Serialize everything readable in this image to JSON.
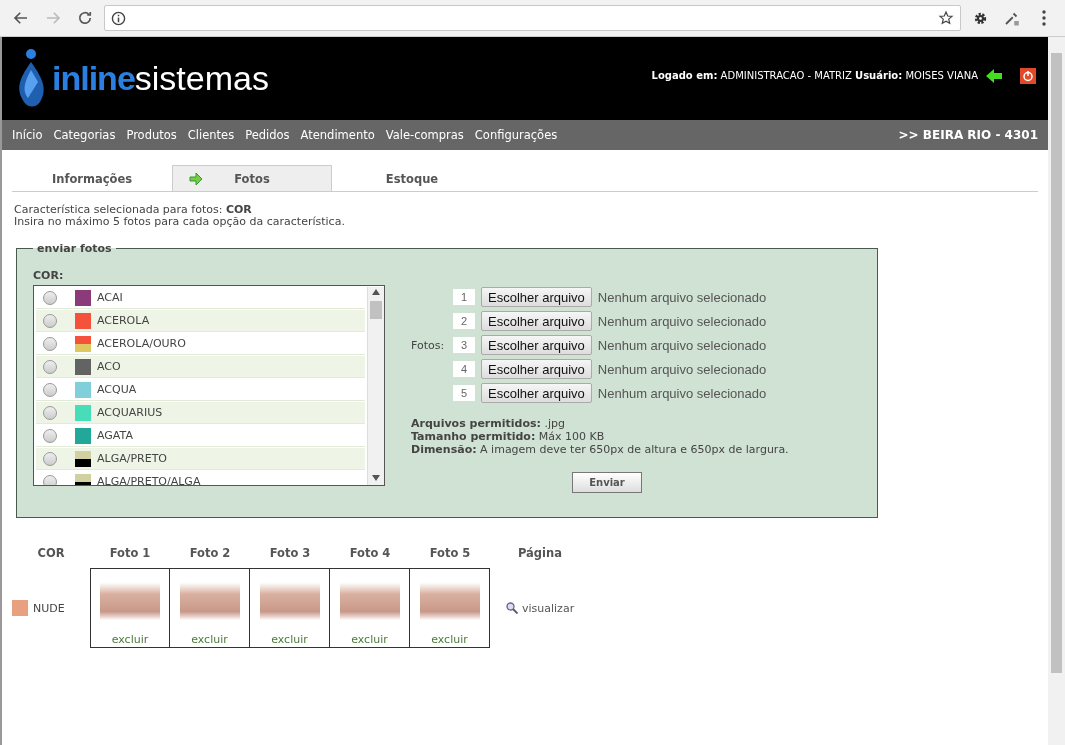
{
  "browser": {
    "nav_buttons": [
      {
        "kind": "back",
        "disabled": false
      },
      {
        "kind": "forward",
        "disabled": true
      },
      {
        "kind": "reload",
        "disabled": false
      }
    ]
  },
  "header": {
    "logo": {
      "part_1": "inline",
      "part_2": "sistemas"
    },
    "session": {
      "logged_label": "Logado em:",
      "location": "ADMINISTRACAO - MATRIZ",
      "user_label": "Usuário:",
      "user": "MOISES VIANA"
    }
  },
  "nav": {
    "items": [
      "Início",
      "Categorias",
      "Produtos",
      "Clientes",
      "Pedidos",
      "Atendimento",
      "Vale-compras",
      "Configurações"
    ],
    "store": ">> BEIRA RIO - 4301"
  },
  "tabs": [
    {
      "label": "Informações",
      "selected": false
    },
    {
      "label": "Fotos",
      "selected": true
    },
    {
      "label": "Estoque",
      "selected": false
    }
  ],
  "info": [
    "Característica selecionada para fotos: **COR**",
    "Insira no máximo 5 fotos para cada opção da característica."
  ],
  "upload": {
    "legend": "enviar fotos",
    "list_label": "COR:",
    "colors": [
      {
        "name": "ACAI",
        "stripes": [
          {
            "color": "#8b3a7a"
          }
        ],
        "selected": false
      },
      {
        "name": "ACEROLA",
        "stripes": [
          {
            "color": "#f4523a"
          }
        ],
        "selected": false
      },
      {
        "name": "ACEROLA/OURO",
        "stripes": [
          {
            "color": "#f4523a"
          },
          {
            "color": "#e0c860"
          }
        ],
        "selected": false
      },
      {
        "name": "ACO",
        "stripes": [
          {
            "color": "#636363"
          }
        ],
        "selected": false
      },
      {
        "name": "ACQUA",
        "stripes": [
          {
            "color": "#80d0dc"
          }
        ],
        "selected": false
      },
      {
        "name": "ACQUARIUS",
        "stripes": [
          {
            "color": "#48dcb8"
          }
        ],
        "selected": false
      },
      {
        "name": "AGATA",
        "stripes": [
          {
            "color": "#22a898"
          }
        ],
        "selected": false
      },
      {
        "name": "ALGA/PRETO",
        "stripes": [
          {
            "color": "#d0d0a0"
          },
          {
            "color": "#000000"
          }
        ],
        "selected": false
      },
      {
        "name": "ALGA/PRETO/ALGA",
        "stripes": [
          {
            "color": "#d0d0a0"
          },
          {
            "color": "#000000"
          }
        ],
        "selected": false
      }
    ],
    "fotos_label": "Fotos:",
    "files": [
      {
        "index": "1",
        "button": "Escolher arquivo",
        "status": "Nenhum arquivo selecionado"
      },
      {
        "index": "2",
        "button": "Escolher arquivo",
        "status": "Nenhum arquivo selecionado"
      },
      {
        "index": "3",
        "button": "Escolher arquivo",
        "status": "Nenhum arquivo selecionado"
      },
      {
        "index": "4",
        "button": "Escolher arquivo",
        "status": "Nenhum arquivo selecionado"
      },
      {
        "index": "5",
        "button": "Escolher arquivo",
        "status": "Nenhum arquivo selecionado"
      }
    ],
    "rules": [
      "**Arquivos permitidos:** .jpg",
      "**Tamanho permitido:** Máx 100 KB",
      "**Dimensão:** A imagem deve ter 650px de altura e 650px de largura."
    ],
    "submit": "Enviar"
  },
  "table": {
    "columns": [
      "COR",
      "Foto 1",
      "Foto 2",
      "Foto 3",
      "Foto 4",
      "Foto 5",
      "Página"
    ],
    "rows": [
      {
        "color_name": "NUDE",
        "color": "#e8a07e",
        "photos": [
          {
            "action": "excluir"
          },
          {
            "action": "excluir"
          },
          {
            "action": "excluir"
          },
          {
            "action": "excluir"
          },
          {
            "action": "excluir"
          }
        ],
        "link": "visualizar"
      }
    ]
  }
}
